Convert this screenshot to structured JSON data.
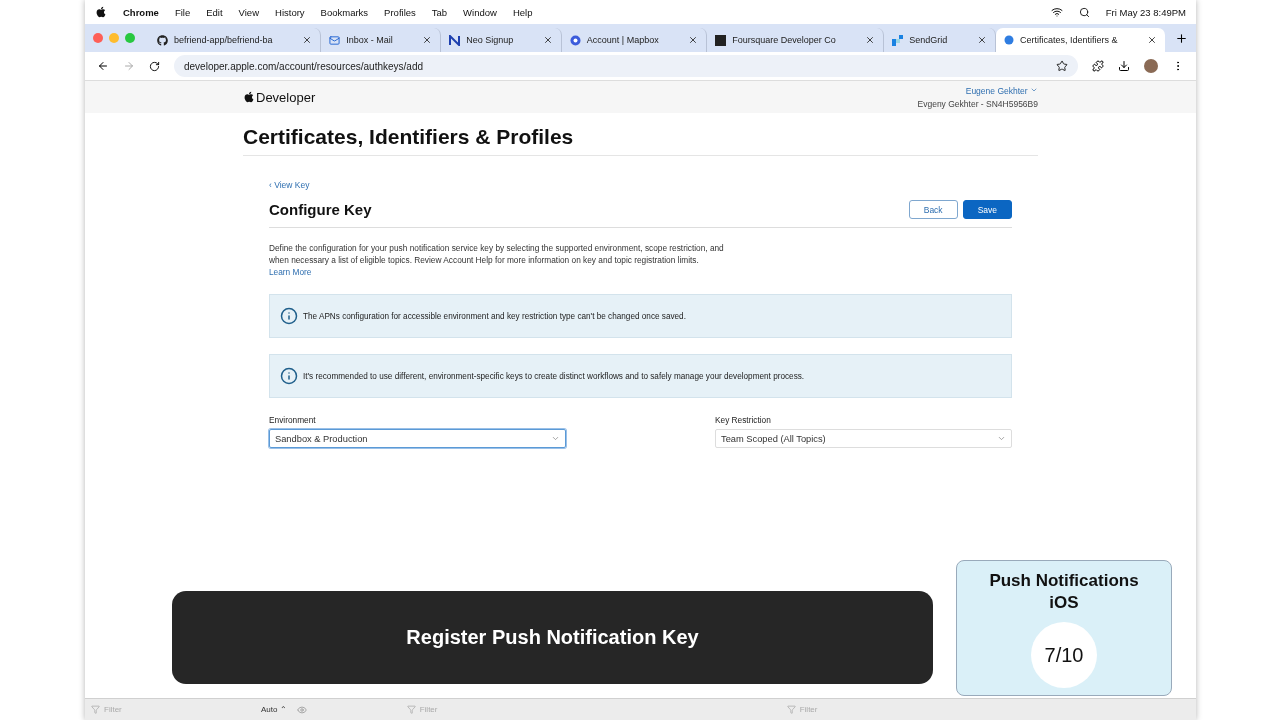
{
  "menu_bar": {
    "app": "Chrome",
    "items": [
      "File",
      "Edit",
      "View",
      "History",
      "Bookmarks",
      "Profiles",
      "Tab",
      "Window",
      "Help"
    ],
    "clock": "Fri May 23  8:49PM"
  },
  "tabs": [
    {
      "label": "befriend-app/befriend-ba",
      "selected": false
    },
    {
      "label": "Inbox - Mail",
      "selected": false
    },
    {
      "label": "Neo Signup",
      "selected": false
    },
    {
      "label": "Account | Mapbox",
      "selected": false
    },
    {
      "label": "Foursquare Developer Co",
      "selected": false
    },
    {
      "label": "SendGrid",
      "selected": false
    },
    {
      "label": "Certificates, Identifiers &",
      "selected": true
    }
  ],
  "address": "developer.apple.com/account/resources/authkeys/add",
  "header": {
    "brand": "Developer",
    "user": "Eugene Gekhter",
    "team": "Evgeny Gekhter - SN4H5956B9"
  },
  "page_title": "Certificates, Identifiers & Profiles",
  "back_link": "‹ View Key",
  "section_title": "Configure Key",
  "buttons": [
    {
      "label": "Back",
      "kind": "secondary"
    },
    {
      "label": "Save",
      "kind": "primary"
    }
  ],
  "description": "Define the configuration for your push notification service key by selecting the supported environment, scope restriction, and when necessary a list of eligible topics. Review Account Help for more information on key and topic registration limits.",
  "learn_more": "Learn More",
  "notices": [
    "The APNs configuration for accessible environment and key restriction type can't be changed once saved.",
    "It's recommended to use different, environment-specific keys to create distinct workflows and to safely manage your development process."
  ],
  "fields": [
    {
      "label": "Environment",
      "value": "Sandbox & Production",
      "focused": true
    },
    {
      "label": "Key Restriction",
      "value": "Team Scoped (All Topics)",
      "focused": false
    }
  ],
  "devtools": {
    "filters": [
      "Filter",
      "Filter",
      "Filter"
    ],
    "mode": "Auto ⌃"
  },
  "caption": "Register Push Notification Key",
  "lesson": {
    "title": "Push Notifications iOS",
    "progress": "7/10"
  }
}
